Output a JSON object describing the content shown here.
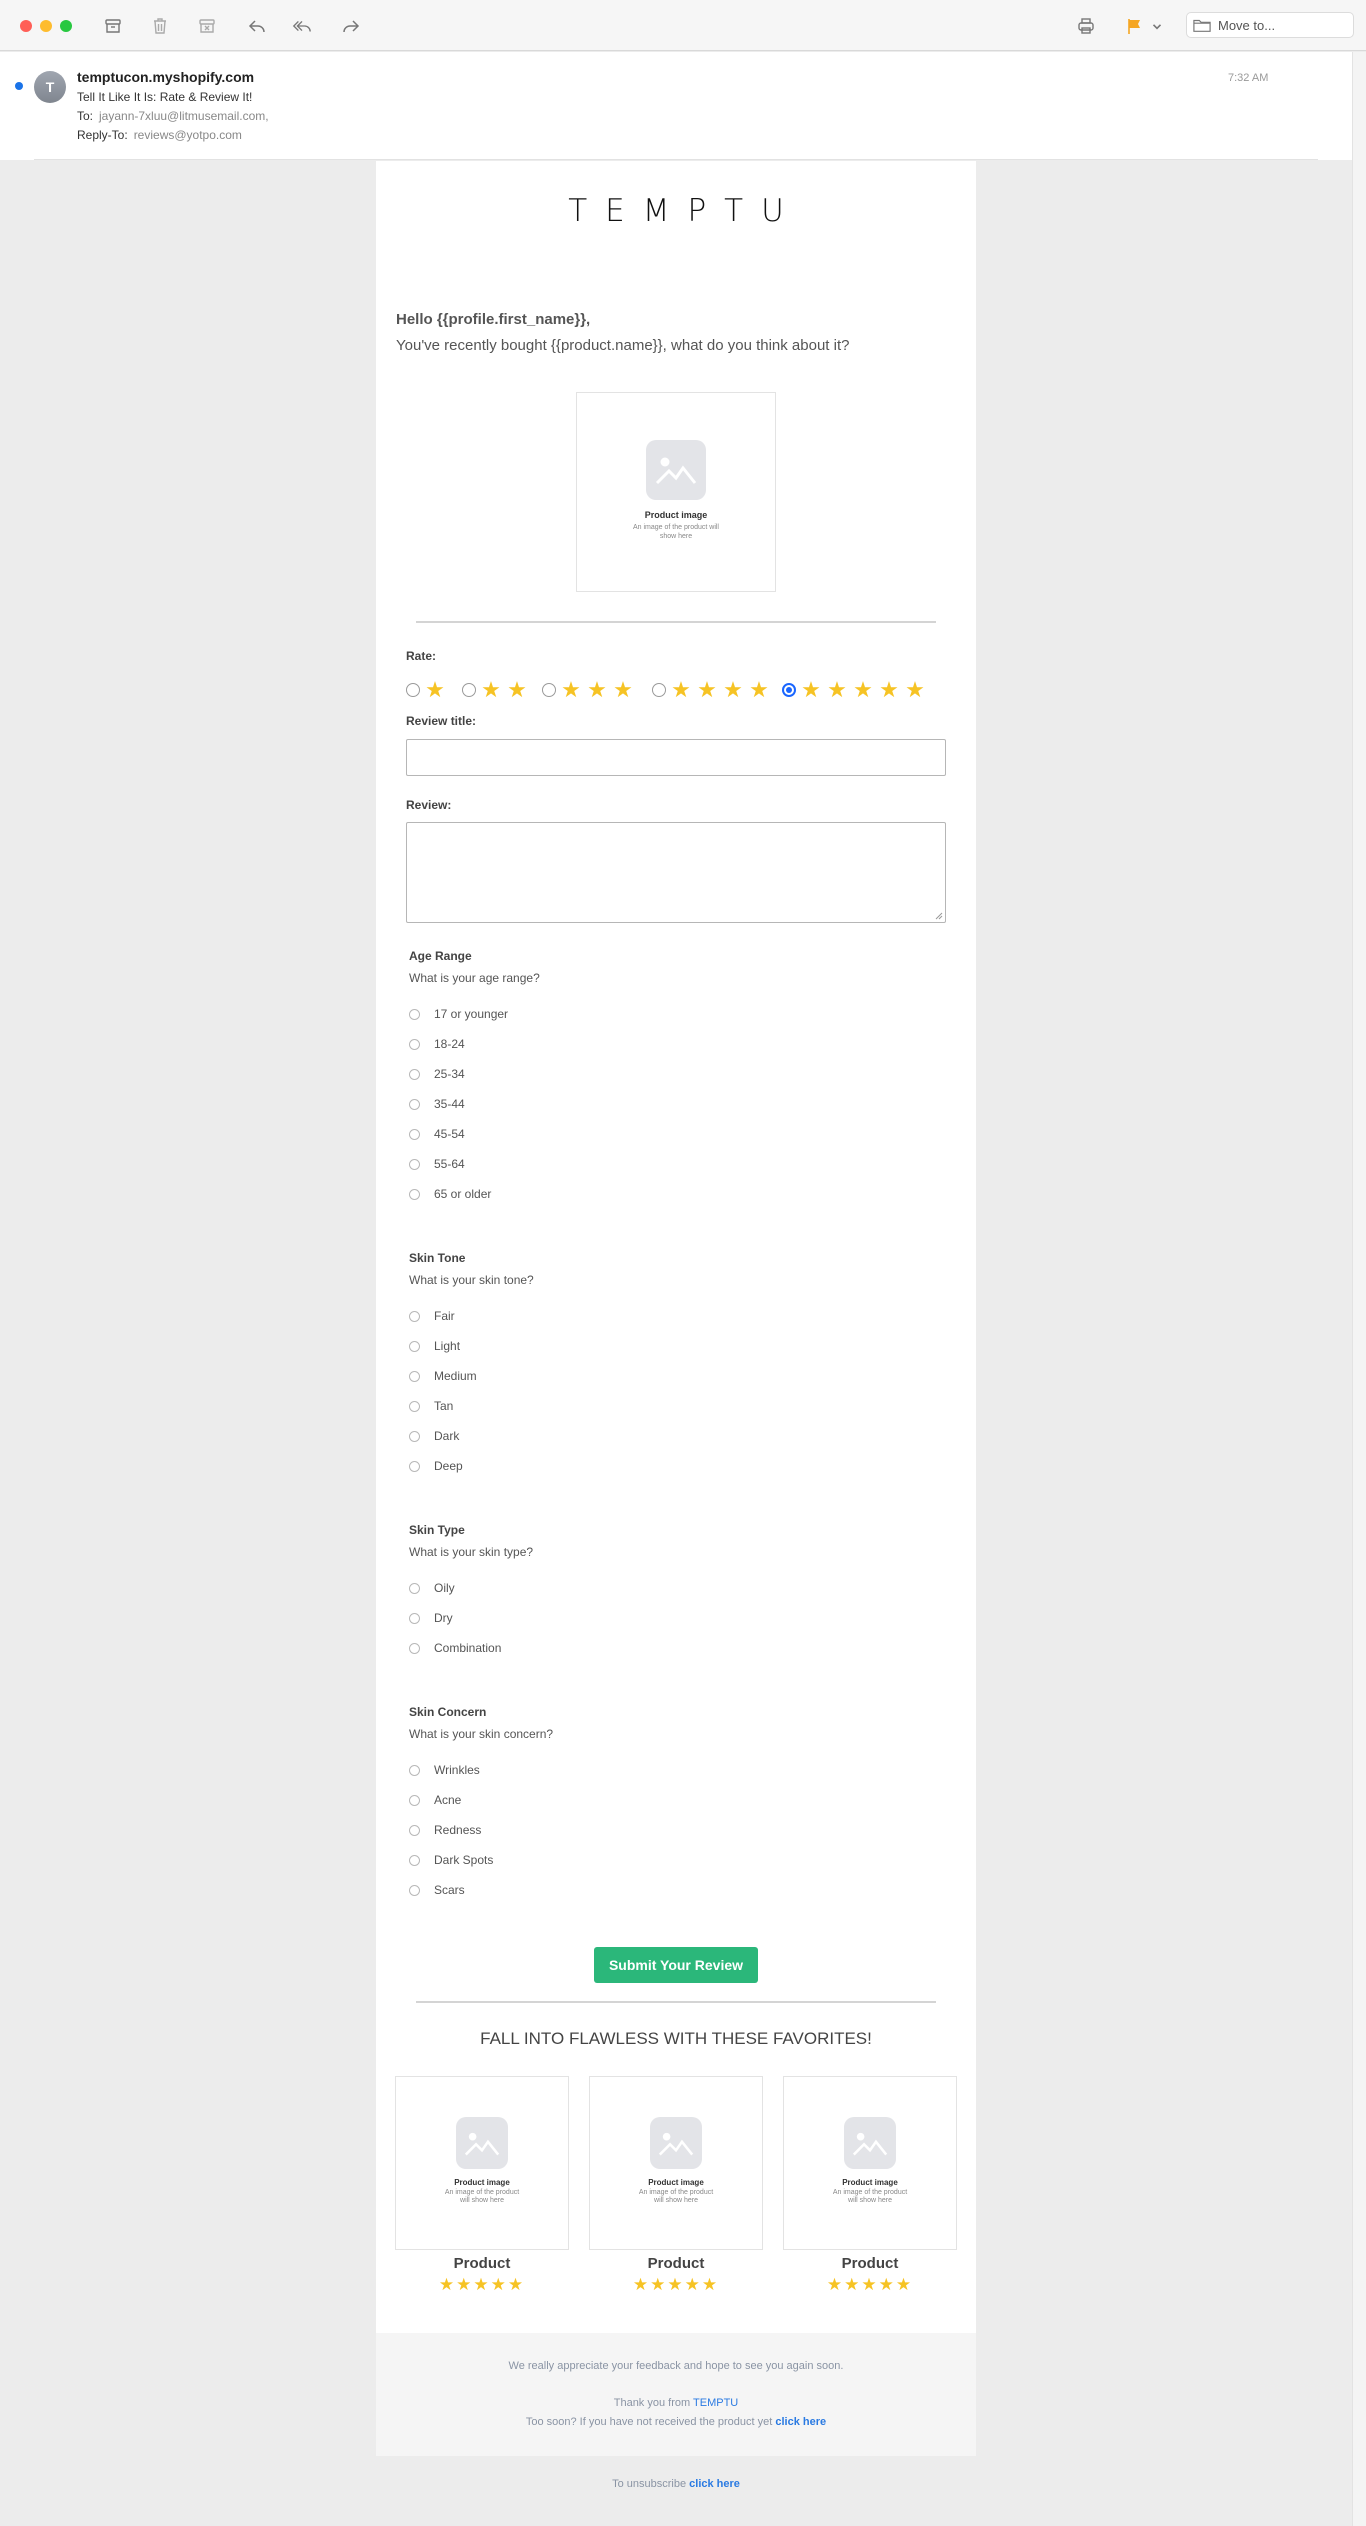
{
  "toolbar": {
    "move_to_label": "Move to...",
    "colors": {
      "close": "#ff5f57",
      "minimize": "#febc2e",
      "zoom": "#28c840",
      "flag": "#f5a623"
    },
    "icons": [
      "archive-icon",
      "trash-icon",
      "junk-icon",
      "reply-icon",
      "reply-all-icon",
      "forward-icon",
      "print-icon",
      "flag-icon",
      "chevron-down-icon",
      "folder-icon"
    ]
  },
  "email": {
    "avatar_initial": "T",
    "sender": "temptucon.myshopify.com",
    "subject": "Tell It Like It Is: Rate & Review It!",
    "to_label": "To:",
    "to_value": "jayann-7xluu@litmusemail.com,",
    "reply_to_label": "Reply-To:",
    "reply_to_value": "reviews@yotpo.com",
    "time": "7:32 AM"
  },
  "body": {
    "brand_logo": "TEMPTU",
    "greeting": "Hello {{profile.first_name}},",
    "intro": "You've recently bought {{product.name}}, what do you think about it?",
    "product_image_title": "Product image",
    "product_image_caption": "An image of the product will show here",
    "rate_label": "Rate:",
    "rating_selected": 5,
    "rating_options": [
      1,
      2,
      3,
      4,
      5
    ],
    "review_title_label": "Review title:",
    "review_label": "Review:",
    "questions": [
      {
        "title": "Age Range",
        "prompt": "What is your age range?",
        "options": [
          "17 or younger",
          "18-24",
          "25-34",
          "35-44",
          "45-54",
          "55-64",
          "65 or older"
        ]
      },
      {
        "title": "Skin Tone",
        "prompt": "What is your skin tone?",
        "options": [
          "Fair",
          "Light",
          "Medium",
          "Tan",
          "Dark",
          "Deep"
        ]
      },
      {
        "title": "Skin Type",
        "prompt": "What is your skin type?",
        "options": [
          "Oily",
          "Dry",
          "Combination"
        ]
      },
      {
        "title": "Skin Concern",
        "prompt": "What is your skin concern?",
        "options": [
          "Wrinkles",
          "Acne",
          "Redness",
          "Dark Spots",
          "Scars"
        ]
      }
    ],
    "submit_label": "Submit Your Review",
    "favorites_title": "FALL INTO FLAWLESS WITH THESE FAVORITES!",
    "products": [
      {
        "name": "Product",
        "rating": 5
      },
      {
        "name": "Product",
        "rating": 5
      },
      {
        "name": "Product",
        "rating": 5
      }
    ],
    "accent_color": "#2bb77a",
    "star_color": "#f6c324"
  },
  "footer": {
    "appreciation": "We really appreciate your feedback and hope to see you again soon.",
    "thanks_prefix": "Thank you from",
    "thanks_brand": "TEMPTU",
    "too_soon": "Too soon? If you have not received the product yet",
    "click_here": "click here",
    "unsubscribe_prefix": "To unsubscribe",
    "unsubscribe_link": "click here"
  }
}
